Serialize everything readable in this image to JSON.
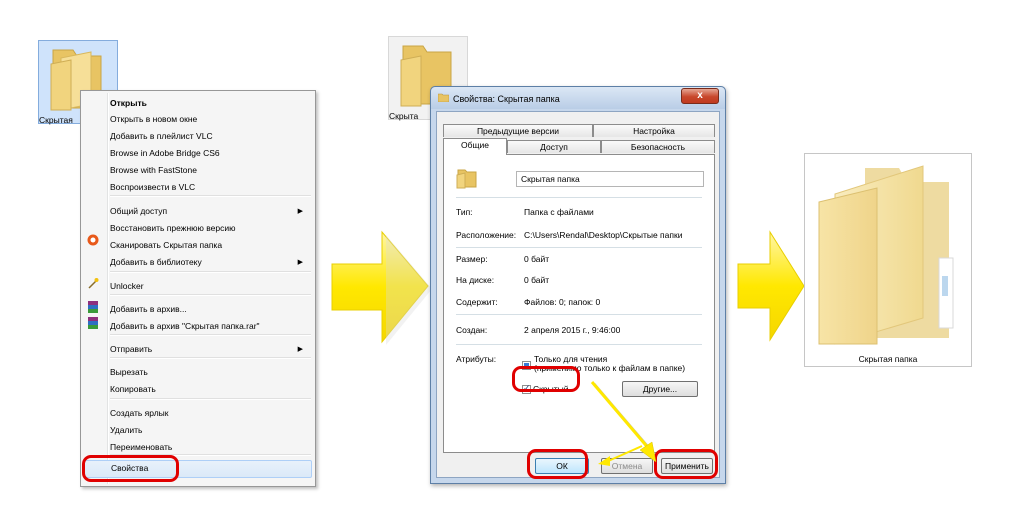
{
  "desktop": {
    "icon_label": "Скрытая"
  },
  "context_menu": {
    "items": [
      {
        "label": "Открыть",
        "bold": true
      },
      {
        "label": "Открыть в новом окне"
      },
      {
        "label": "Добавить в плейлист VLC"
      },
      {
        "label": "Browse in Adobe Bridge CS6"
      },
      {
        "label": "Browse with FastStone"
      },
      {
        "label": "Воспроизвести в VLC"
      },
      {
        "label": "Общий доступ",
        "submenu": true
      },
      {
        "label": "Восстановить прежнюю версию"
      },
      {
        "label": "Сканировать Скрытая папка"
      },
      {
        "label": "Добавить в библиотеку",
        "submenu": true
      },
      {
        "label": "Unlocker"
      },
      {
        "label": "Добавить в архив..."
      },
      {
        "label": "Добавить в архив \"Скрытая папка.rar\""
      },
      {
        "label": "Отправить",
        "submenu": true
      },
      {
        "label": "Вырезать"
      },
      {
        "label": "Копировать"
      },
      {
        "label": "Создать ярлык"
      },
      {
        "label": "Удалить"
      },
      {
        "label": "Переименовать"
      },
      {
        "label": "Свойства",
        "highlighted": true
      }
    ],
    "submenu_glyph": "▶"
  },
  "dialog": {
    "ghost_label": "Скрыта",
    "title": "Свойства: Скрытая папка",
    "close_glyph": "x",
    "tabs_back": [
      "Предыдущие версии",
      "Настройка"
    ],
    "tabs_front": [
      "Общие",
      "Доступ",
      "Безопасность"
    ],
    "folder_name": "Скрытая папка",
    "props": {
      "type_label": "Тип:",
      "type_value": "Папка с файлами",
      "location_label": "Расположение:",
      "location_value": "C:\\Users\\Rendal\\Desktop\\Скрытые папки",
      "size_label": "Размер:",
      "size_value": "0 байт",
      "disk_label": "На диске:",
      "disk_value": "0 байт",
      "contains_label": "Содержит:",
      "contains_value": "Файлов: 0; папок: 0",
      "created_label": "Создан:",
      "created_value": "2 апреля 2015 г., 9:46:00",
      "attributes_label": "Атрибуты:"
    },
    "readonly_label": "Только для чтения",
    "readonly_note": "(применимо только к файлам в папке)",
    "hidden_label": "Скрытый",
    "other_button": "Другие...",
    "ok_button": "ОК",
    "cancel_button": "Отмена",
    "apply_button": "Применить"
  },
  "result": {
    "label": "Скрытая папка"
  },
  "colors": {
    "highlight_ring": "#e00000",
    "arrow_yellow": "#ffe800",
    "folder": "#f1d47e"
  }
}
